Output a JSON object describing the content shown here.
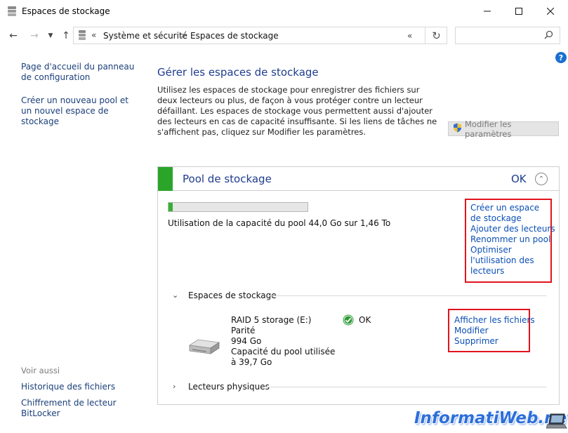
{
  "window": {
    "title": "Espaces de stockage",
    "app_icon": "storage-spaces-icon",
    "controls": [
      "minimize-icon",
      "maximize-icon",
      "close-icon"
    ]
  },
  "address_bar": {
    "overflow": "«",
    "breadcrumb": [
      "Système et sécurité",
      "Espaces de stockage"
    ],
    "separator": ">",
    "search_placeholder": ""
  },
  "sidebar": {
    "links": [
      "Page d'accueil du panneau de configuration",
      "Créer un nouveau pool et un nouvel espace de stockage"
    ],
    "see_also_title": "Voir aussi",
    "see_also": [
      "Historique des fichiers",
      "Chiffrement de lecteur BitLocker"
    ]
  },
  "main": {
    "title": "Gérer les espaces de stockage",
    "description": "Utilisez les espaces de stockage pour enregistrer des fichiers sur deux lecteurs ou plus, de façon à vous protéger contre un lecteur défaillant. Les espaces de stockage vous permettent aussi d'ajouter des lecteurs en cas de capacité insuffisante. Si les liens de tâches ne s'affichent pas, cliquez sur Modifier les paramètres.",
    "modify_button": "Modifier les paramètres"
  },
  "pool": {
    "name": "Pool de stockage",
    "status": "OK",
    "usage_fraction": 0.03,
    "usage_text": "Utilisation de la capacité du pool 44,0 Go sur 1,46 To",
    "actions": [
      "Créer un espace de stockage",
      "Ajouter des lecteurs",
      "Renommer un pool",
      "Optimiser l'utilisation des lecteurs"
    ],
    "spaces_section": "Espaces de stockage",
    "space": {
      "name": "RAID 5 storage (E:)",
      "type": "Parité",
      "size": "994 Go",
      "pool_used": "Capacité du pool utilisée à 39,7 Go",
      "status": "OK",
      "actions": [
        "Afficher les fichiers",
        "Modifier",
        "Supprimer"
      ]
    },
    "physical_section": "Lecteurs physiques"
  },
  "watermark": "InformatiWeb.net",
  "colors": {
    "accent_green": "#2aa52a",
    "title_blue": "#1e3d8f",
    "link_blue": "#0b4fb5",
    "highlight_red": "#e0141e"
  }
}
